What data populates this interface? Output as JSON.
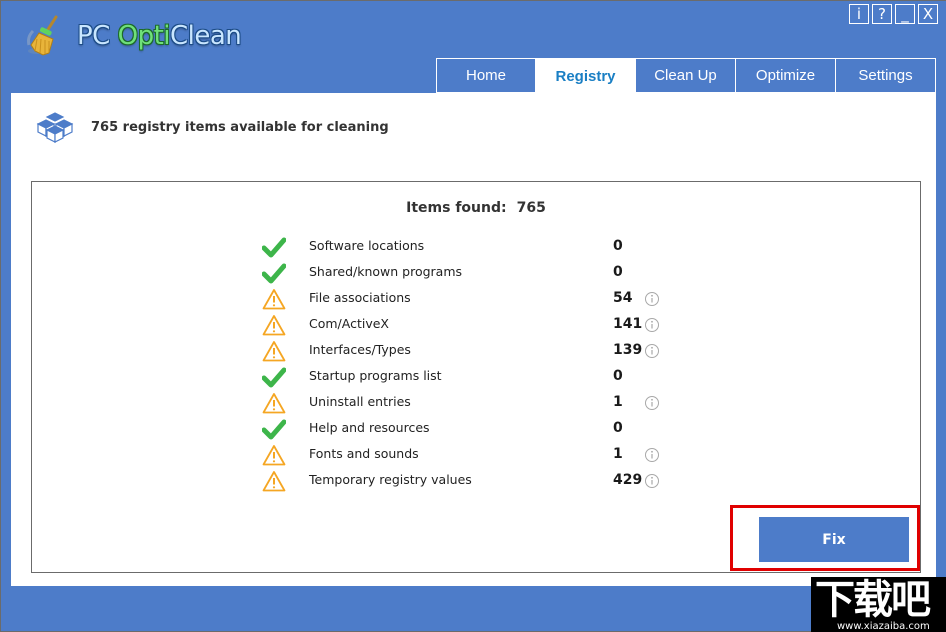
{
  "app": {
    "title_parts": {
      "pc": "PC ",
      "opti": "Opti",
      "clean": "Clean"
    },
    "logo_icon": "broom-icon"
  },
  "window_controls": [
    {
      "name": "info-button",
      "label": "i"
    },
    {
      "name": "help-button",
      "label": "?"
    },
    {
      "name": "minimize-button",
      "label": "_"
    },
    {
      "name": "close-button",
      "label": "X"
    }
  ],
  "tabs": [
    {
      "label": "Home",
      "active": false
    },
    {
      "label": "Registry",
      "active": true
    },
    {
      "label": "Clean Up",
      "active": false
    },
    {
      "label": "Optimize",
      "active": false
    },
    {
      "label": "Settings",
      "active": false
    }
  ],
  "header": {
    "icon": "registry-cubes-icon",
    "text": "765 registry items available for cleaning"
  },
  "results": {
    "items_found_label": "Items found:",
    "items_found_count": "765",
    "rows": [
      {
        "label": "Software locations",
        "count": "0",
        "status": "ok",
        "info": false
      },
      {
        "label": "Shared/known programs",
        "count": "0",
        "status": "ok",
        "info": false
      },
      {
        "label": "File associations",
        "count": "54",
        "status": "warning",
        "info": true
      },
      {
        "label": "Com/ActiveX",
        "count": "141",
        "status": "warning",
        "info": true
      },
      {
        "label": "Interfaces/Types",
        "count": "139",
        "status": "warning",
        "info": true
      },
      {
        "label": "Startup programs list",
        "count": "0",
        "status": "ok",
        "info": false
      },
      {
        "label": "Uninstall entries",
        "count": "1",
        "status": "warning",
        "info": true
      },
      {
        "label": "Help and resources",
        "count": "0",
        "status": "ok",
        "info": false
      },
      {
        "label": "Fonts and sounds",
        "count": "1",
        "status": "warning",
        "info": true
      },
      {
        "label": "Temporary registry values",
        "count": "429",
        "status": "warning",
        "info": true
      }
    ]
  },
  "actions": {
    "fix_label": "Fix"
  },
  "watermark": {
    "title": "下载吧",
    "url": "www.xiazaiba.com"
  },
  "colors": {
    "brand_blue": "#4d7cc9",
    "active_tab_text": "#1a7fc4",
    "ok_green": "#3db54a",
    "warning_orange": "#f5a623",
    "highlight_red": "#e00000"
  }
}
